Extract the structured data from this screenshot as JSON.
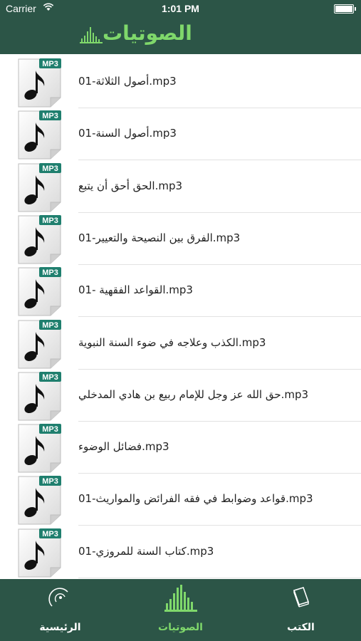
{
  "status": {
    "carrier": "Carrier",
    "time": "1:01 PM"
  },
  "header": {
    "title": "الصوتيات"
  },
  "items": [
    {
      "label": "01-أصول الثلاثة.mp3"
    },
    {
      "label": "أصول السنة-01.mp3"
    },
    {
      "label": "الحق أحق أن يتبع.mp3"
    },
    {
      "label": "الفرق بين النصيحة والتعيير-01.mp3"
    },
    {
      "label": "القواعد الفقهية -01.mp3"
    },
    {
      "label": "الكذب وعلاجه في ضوء السنة النبوية.mp3"
    },
    {
      "label": "حق الله عز وجل للإمام ربيع بن هادي المدخلي.mp3"
    },
    {
      "label": "فضائل الوضوء.mp3"
    },
    {
      "label": "قواعد وضوابط في فقه الفرائض والمواريث-01.mp3"
    },
    {
      "label": "كتاب السنة للمروزي-01.mp3"
    },
    {
      "label": ""
    }
  ],
  "thumb_badge": "MP3",
  "tabs": [
    {
      "label": "الرئيسية",
      "icon": "home-icon",
      "active": false
    },
    {
      "label": "الصوتيات",
      "icon": "audio-waveform-icon",
      "active": true
    },
    {
      "label": "الكتب",
      "icon": "book-icon",
      "active": false
    }
  ],
  "colors": {
    "bar": "#2c5547",
    "accent": "#7fd86b",
    "badge": "#1f7f6e"
  }
}
